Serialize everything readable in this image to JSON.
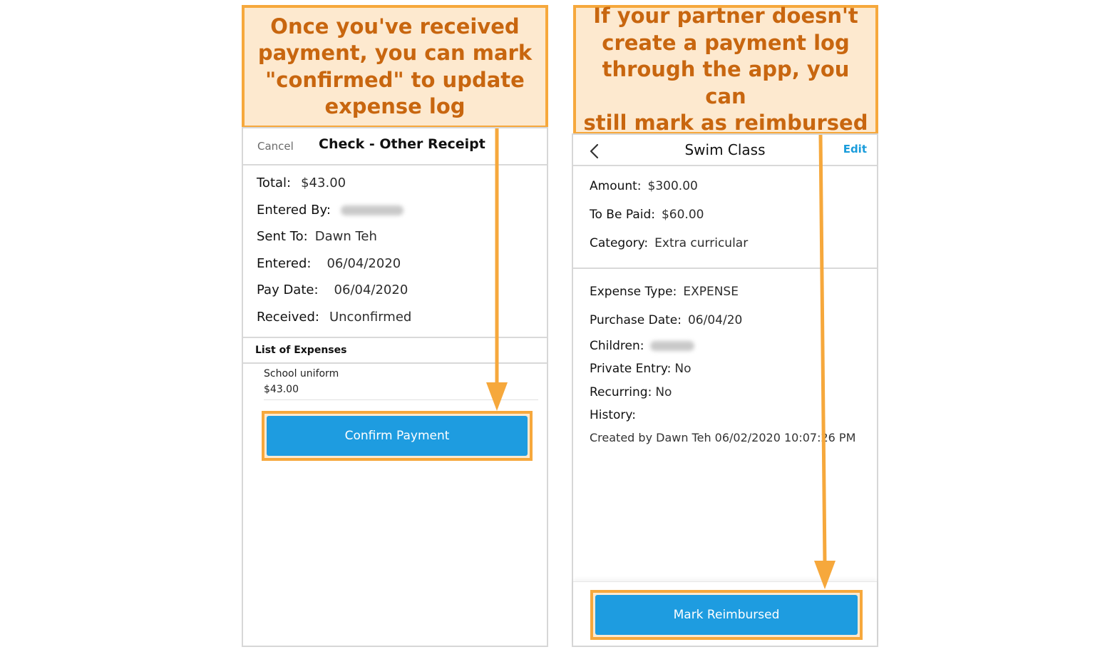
{
  "callouts": {
    "left": [
      "Once you've received",
      "payment, you can mark",
      "\"confirmed\" to update",
      "expense log"
    ],
    "right": [
      "If your partner doesn't",
      "create a payment log",
      "through the app, you can",
      "still mark as reimbursed"
    ]
  },
  "left_screen": {
    "cancel_label": "Cancel",
    "title": "Check - Other Receipt",
    "fields": [
      {
        "label": "Total:",
        "value": "$43.00"
      },
      {
        "label": "Entered By:",
        "value": ""
      },
      {
        "label": "Sent To:",
        "value": "Dawn Teh"
      },
      {
        "label": "Entered:",
        "value": "06/04/2020"
      },
      {
        "label": "Pay Date:",
        "value": "06/04/2020"
      },
      {
        "label": "Received:",
        "value": "Unconfirmed"
      }
    ],
    "list_heading": "List of Expenses",
    "expenses": [
      {
        "name": "School uniform",
        "amount": "$43.00"
      }
    ],
    "confirm_button": "Confirm Payment"
  },
  "right_screen": {
    "title": "Swim Class",
    "edit_label": "Edit",
    "summary": [
      {
        "label": "Amount:",
        "value": "$300.00"
      },
      {
        "label": "To Be Paid:",
        "value": "$60.00"
      },
      {
        "label": "Category:",
        "value": "Extra curricular"
      }
    ],
    "details": [
      {
        "label": "Expense Type:",
        "value": "EXPENSE"
      },
      {
        "label": "Purchase Date:",
        "value": "06/04/20"
      },
      {
        "label": "Children:",
        "value": ""
      },
      {
        "label": "Private Entry:",
        "value": "No"
      },
      {
        "label": "Recurring:",
        "value": "No"
      },
      {
        "label": "History:",
        "value": ""
      }
    ],
    "history_text": "Created by Dawn Teh 06/02/2020 10:07:26 PM",
    "reimburse_button": "Mark Reimbursed"
  },
  "colors": {
    "accent_orange": "#f6a83c",
    "callout_text": "#c8660f",
    "callout_fill": "#fde9cf",
    "button_blue": "#1e9ce0",
    "link_blue": "#1a9cdb"
  },
  "icons": [
    "chevron-left-icon",
    "arrow-down-icon"
  ]
}
